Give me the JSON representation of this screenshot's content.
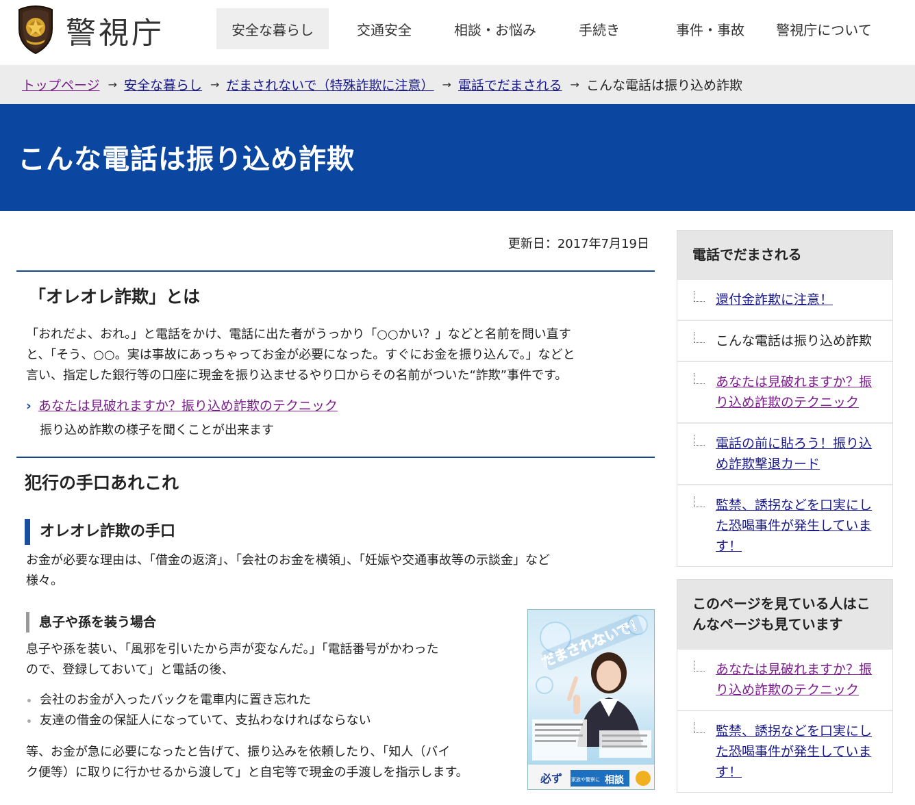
{
  "header": {
    "site_name": "警視庁",
    "nav": [
      {
        "label": "安全な暮らし",
        "active": true
      },
      {
        "label": "交通安全",
        "active": false
      },
      {
        "label": "相談・お悩み",
        "active": false
      },
      {
        "label": "手続き",
        "active": false
      },
      {
        "label": "事件・事故",
        "active": false
      },
      {
        "label": "警視庁について",
        "active": false
      }
    ]
  },
  "breadcrumb": {
    "items": [
      "トップページ",
      "安全な暮らし",
      "だまされないで（特殊詐欺に注意）",
      "電話でだまされる"
    ],
    "current": "こんな電話は振り込め詐欺",
    "arrow": "→"
  },
  "page": {
    "title": "こんな電話は振り込め詐欺",
    "updated": "更新日：2017年7月19日"
  },
  "section1": {
    "heading": "「オレオレ詐欺」とは",
    "lines": [
      "「おれだよ、おれ。」と電話をかけ、電話に出た者がうっかり「○○かい？」などと名前を問い直す",
      "と、「そう、○○。実は事故にあっちゃってお金が必要になった。すぐにお金を振り込んで。」などと",
      "言い、指定した銀行等の口座に現金を振り込ませるやり口からその名前がついた“詐欺”事件です。"
    ],
    "link_label": "あなたは見破れますか？振り込め詐欺のテクニック",
    "link_sub": "振り込め詐欺の様子を聞くことが出来ます"
  },
  "section2": {
    "heading": "犯行の手口あれこれ",
    "subheading": "オレオレ詐欺の手口",
    "lines": [
      "お金が必要な理由は、「借金の返済」、「会社のお金を横領」、「妊娠や交通事故等の示談金」など",
      "様々。"
    ],
    "case_heading": "息子や孫を装う場合",
    "case_lines": [
      "息子や孫を装い、「風邪を引いたから声が変なんだ。」「電話番号がかわった",
      "ので、登録しておいて」と電話の後、"
    ],
    "bullets": [
      "会社のお金が入ったバックを電車内に置き忘れた",
      "友達の借金の保証人になっていて、支払わなければならない"
    ],
    "closing_lines": [
      "等、お金が急に必要になったと告げて、振り込みを依頼したり、「知人（バイ",
      "ク便等）に取りに行かせるから渡して」と自宅等で現金の手渡しを指示します。"
    ]
  },
  "poster": {
    "headline": "だまされないで！",
    "footer_bold": "必ず",
    "footer_mid": "家族や警察に",
    "footer_end": "相談"
  },
  "sidebar": {
    "box1": {
      "heading": "電話でだまされる",
      "items": [
        {
          "lines": [
            "還付金詐欺に注意！"
          ],
          "kind": "link"
        },
        {
          "lines": [
            "こんな電話は振り込め詐欺"
          ],
          "kind": "current"
        },
        {
          "lines": [
            "あなたは見破れますか？振",
            "り込め詐欺のテクニック"
          ],
          "kind": "visited"
        },
        {
          "lines": [
            "電話の前に貼ろう！振り込",
            "め詐欺撃退カード"
          ],
          "kind": "link"
        },
        {
          "lines": [
            "監禁、誘拐などを口実にし",
            "た恐喝事件が発生していま",
            "す！"
          ],
          "kind": "link"
        }
      ]
    },
    "box2": {
      "heading_lines": [
        "このページを見ている人はこ",
        "んなページも見ています"
      ],
      "items": [
        {
          "lines": [
            "あなたは見破れますか？振",
            "り込め詐欺のテクニック"
          ],
          "kind": "visited"
        },
        {
          "lines": [
            "監禁、誘拐などを口実にし",
            "た恐喝事件が発生していま",
            "す！"
          ],
          "kind": "link"
        }
      ]
    }
  },
  "colors": {
    "title_band": "#0b46a0",
    "rule": "#16468f",
    "link": "#1a1a8a",
    "visited": "#7b1d8c"
  }
}
